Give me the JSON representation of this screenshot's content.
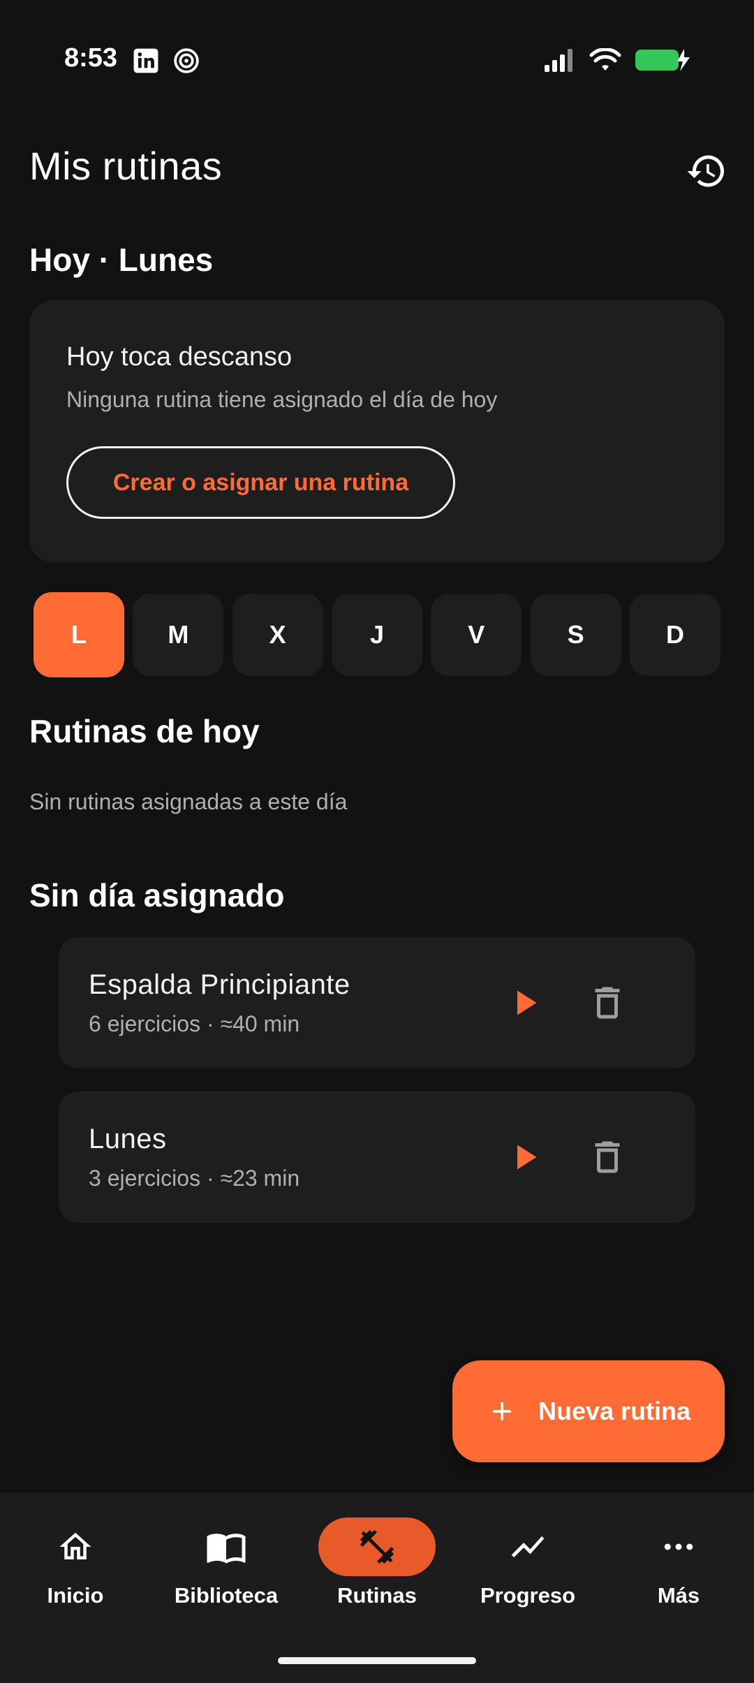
{
  "status_bar": {
    "time": "8:53",
    "app_icons": [
      "linkedin-icon",
      "threads-icon"
    ],
    "signal_icon": "signal-icon",
    "wifi_icon": "wifi-icon",
    "battery_icon": "battery-charging-icon",
    "battery_color": "#34c759"
  },
  "header": {
    "title": "Mis rutinas",
    "history_icon": "history-icon"
  },
  "today": {
    "section_title": "Hoy · Lunes",
    "card_title": "Hoy toca descanso",
    "card_subtitle": "Ninguna rutina tiene asignado el día de hoy",
    "button_label": "Crear o asignar una rutina"
  },
  "days": [
    {
      "label": "L",
      "active": true
    },
    {
      "label": "M",
      "active": false
    },
    {
      "label": "X",
      "active": false
    },
    {
      "label": "J",
      "active": false
    },
    {
      "label": "V",
      "active": false
    },
    {
      "label": "S",
      "active": false
    },
    {
      "label": "D",
      "active": false
    }
  ],
  "today_routines": {
    "section_title": "Rutinas de hoy",
    "empty_text": "Sin rutinas asignadas a este día"
  },
  "unassigned": {
    "section_title": "Sin día asignado",
    "routines": [
      {
        "name": "Espalda Principiante",
        "meta": "6 ejercicios · ≈40 min"
      },
      {
        "name": "Lunes",
        "meta": "3 ejercicios · ≈23 min"
      }
    ]
  },
  "fab": {
    "label": "Nueva rutina",
    "icon": "plus-icon"
  },
  "bottom_nav": {
    "items": [
      {
        "label": "Inicio",
        "icon": "home-icon",
        "active": false
      },
      {
        "label": "Biblioteca",
        "icon": "book-icon",
        "active": false
      },
      {
        "label": "Rutinas",
        "icon": "dumbbell-icon",
        "active": true
      },
      {
        "label": "Progreso",
        "icon": "trending-icon",
        "active": false
      },
      {
        "label": "Más",
        "icon": "more-icon",
        "active": false
      }
    ]
  },
  "colors": {
    "accent": "#ff6b35",
    "background": "#121212",
    "card": "#1e1e1e",
    "nav_active": "#e85a2a"
  }
}
